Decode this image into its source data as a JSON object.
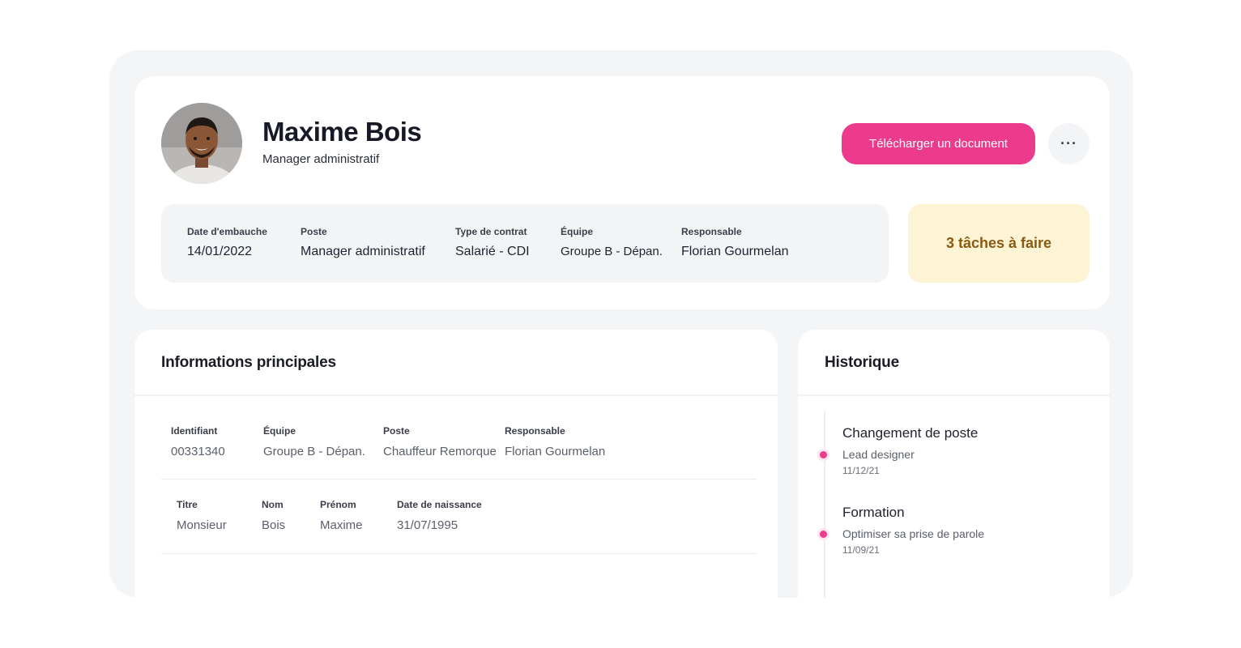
{
  "profile": {
    "name": "Maxime Bois",
    "role": "Manager administratif",
    "download_button": "Télécharger un document",
    "more_button": "···"
  },
  "summary": [
    {
      "label": "Date d'embauche",
      "value": "14/01/2022"
    },
    {
      "label": "Poste",
      "value": "Manager administratif"
    },
    {
      "label": "Type de contrat",
      "value": "Salarié - CDI"
    },
    {
      "label": "Équipe",
      "value": "Groupe B - Dépan."
    },
    {
      "label": "Responsable",
      "value": "Florian Gourmelan"
    }
  ],
  "tasks": {
    "label": "3 tâches à faire"
  },
  "info": {
    "title": "Informations principales",
    "row1": [
      {
        "label": "Identifiant",
        "value": "00331340"
      },
      {
        "label": "Équipe",
        "value": "Groupe B - Dépan."
      },
      {
        "label": "Poste",
        "value": "Chauffeur Remorque"
      },
      {
        "label": "Responsable",
        "value": "Florian Gourmelan"
      }
    ],
    "row2": [
      {
        "label": "Titre",
        "value": "Monsieur"
      },
      {
        "label": "Nom",
        "value": "Bois"
      },
      {
        "label": "Prénom",
        "value": "Maxime"
      },
      {
        "label": "Date de naissance",
        "value": "31/07/1995"
      }
    ]
  },
  "history": {
    "title": "Historique",
    "items": [
      {
        "title": "Changement de poste",
        "subtitle": "Lead designer",
        "date": "11/12/21"
      },
      {
        "title": "Formation",
        "subtitle": "Optimiser sa prise de parole",
        "date": "11/09/21"
      }
    ]
  },
  "colors": {
    "accent": "#ec3b8c",
    "tasks_bg": "#fdf4d6",
    "tasks_text": "#8a5a12",
    "frame_bg": "#f4f5f7"
  }
}
